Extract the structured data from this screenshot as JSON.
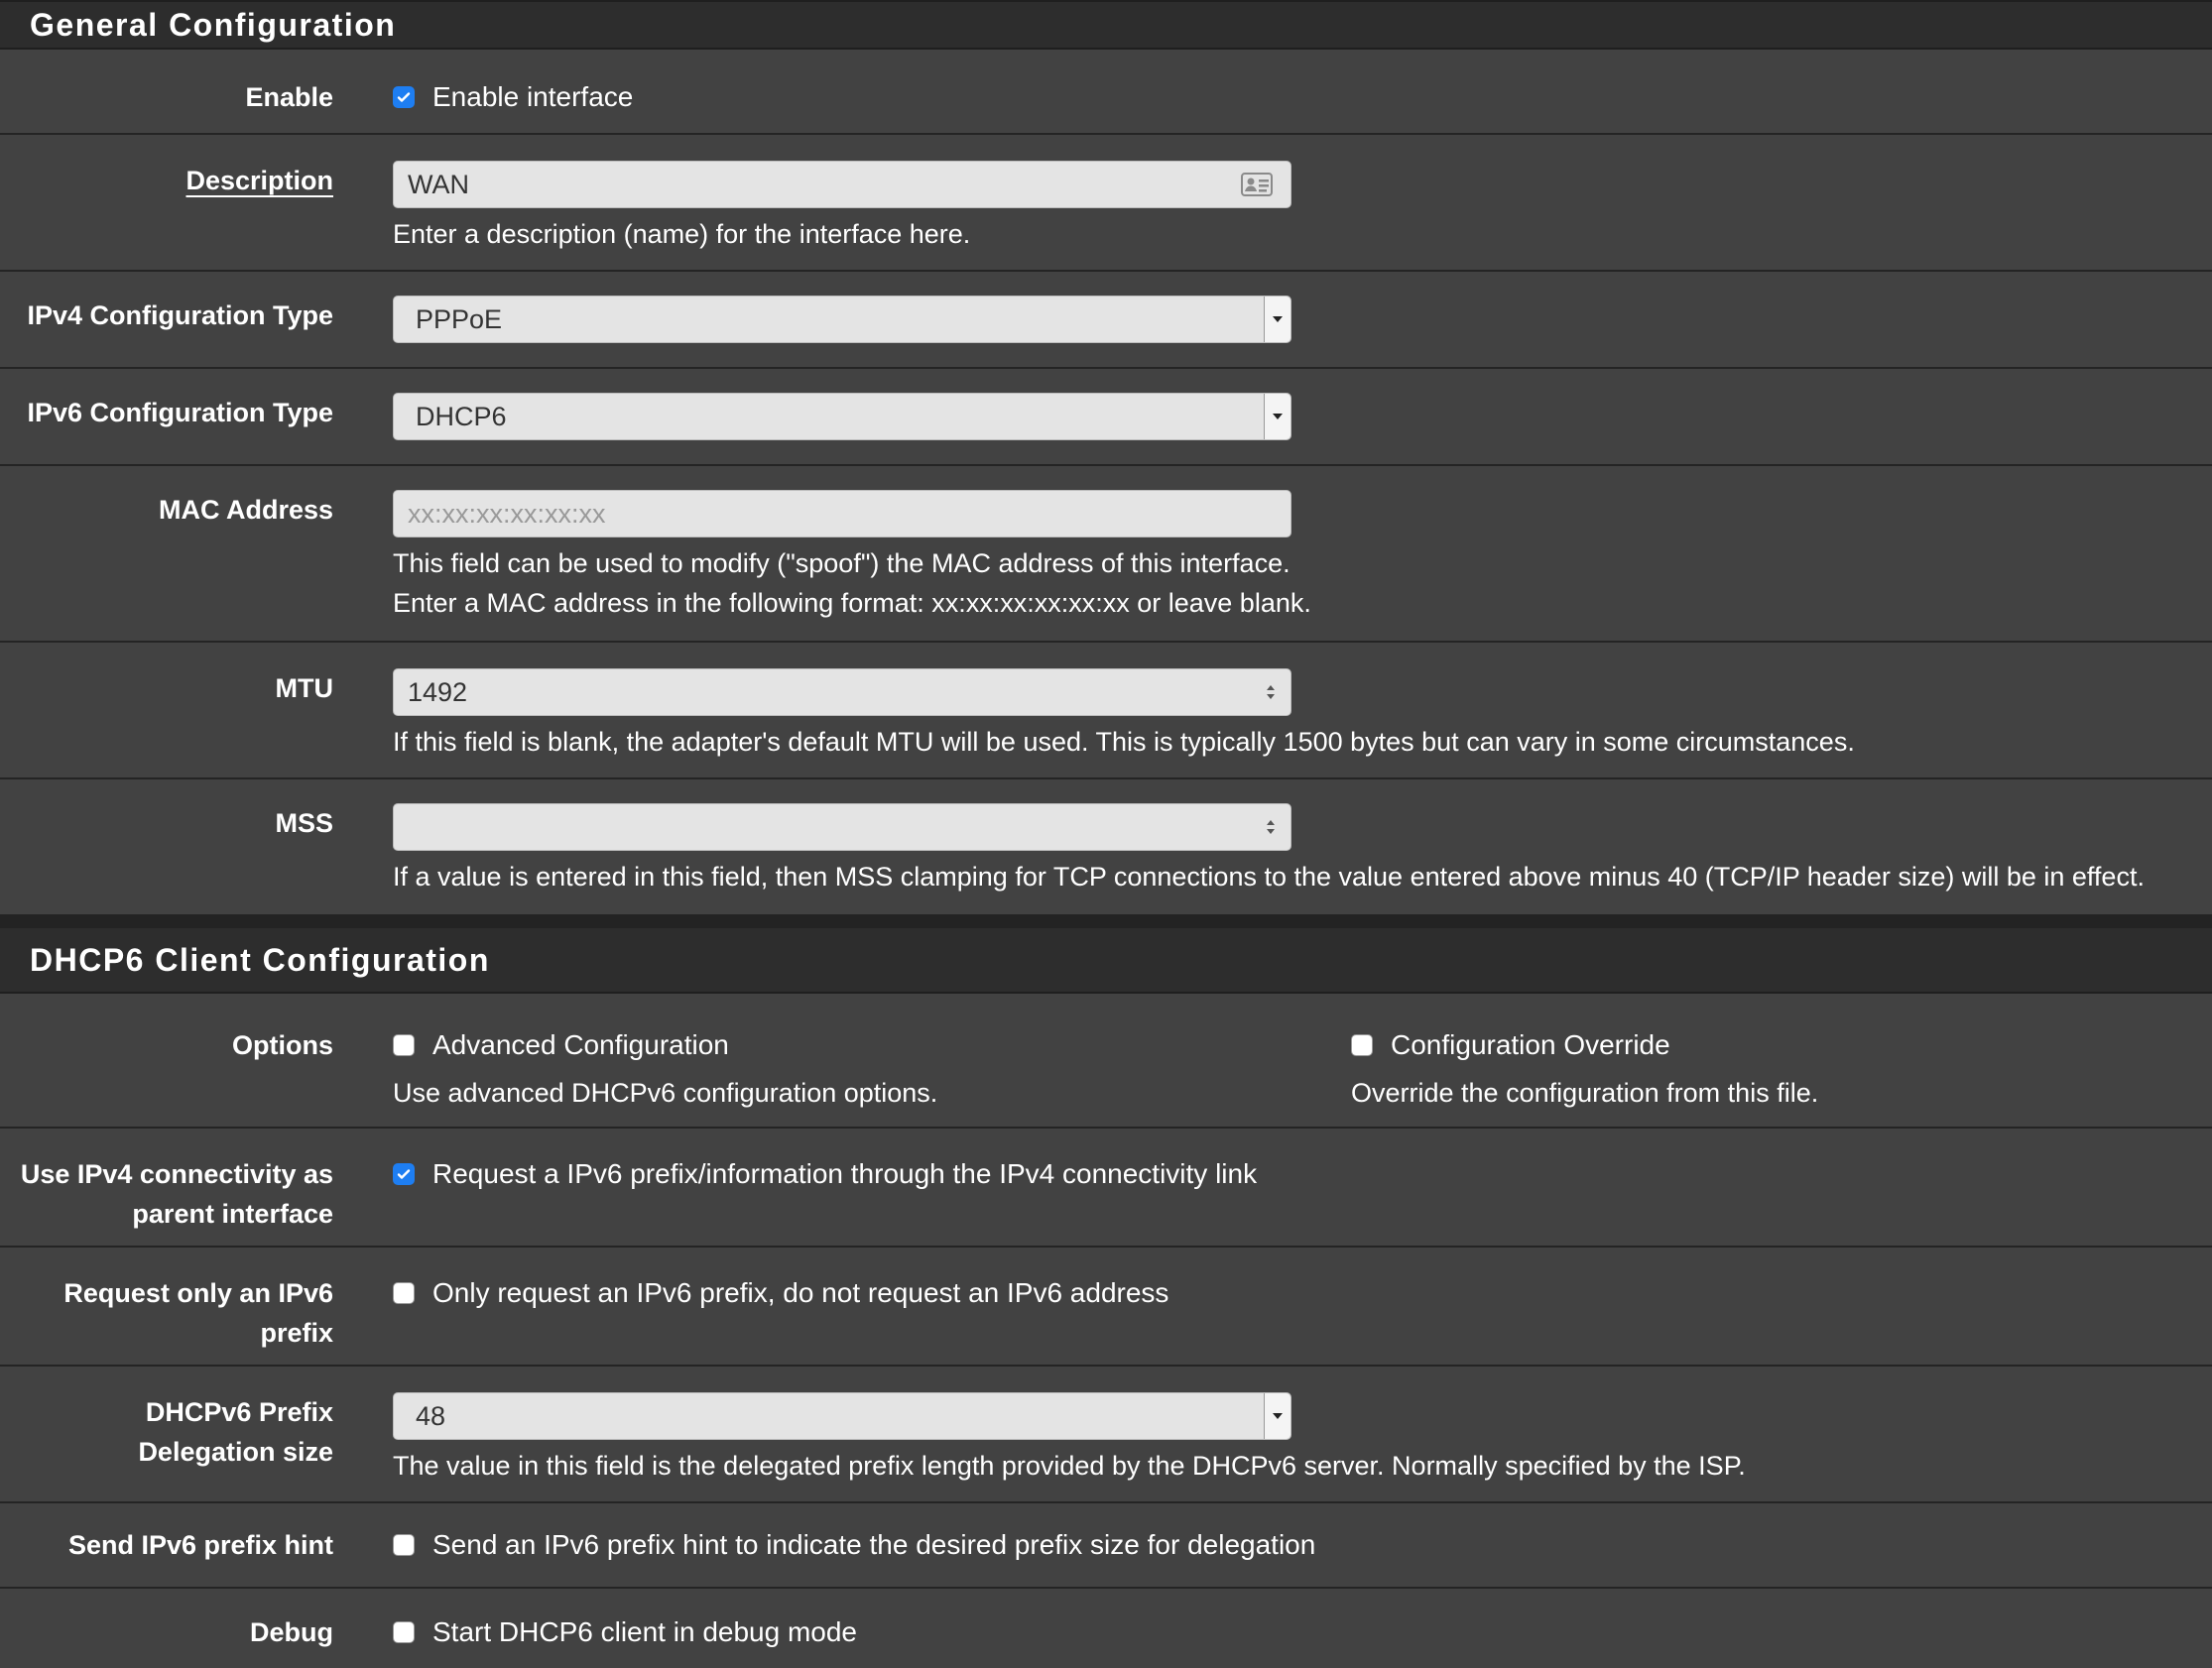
{
  "general": {
    "title": "General Configuration",
    "enable": {
      "label": "Enable",
      "checkbox_label": "Enable interface",
      "checked": true
    },
    "description": {
      "label": "Description",
      "value": "WAN",
      "help": "Enter a description (name) for the interface here."
    },
    "ipv4_type": {
      "label": "IPv4 Configuration Type",
      "value": "PPPoE"
    },
    "ipv6_type": {
      "label": "IPv6 Configuration Type",
      "value": "DHCP6"
    },
    "mac": {
      "label": "MAC Address",
      "placeholder": "xx:xx:xx:xx:xx:xx",
      "help1": "This field can be used to modify (\"spoof\") the MAC address of this interface.",
      "help2": "Enter a MAC address in the following format: xx:xx:xx:xx:xx:xx or leave blank."
    },
    "mtu": {
      "label": "MTU",
      "value": "1492",
      "help": "If this field is blank, the adapter's default MTU will be used. This is typically 1500 bytes but can vary in some circumstances."
    },
    "mss": {
      "label": "MSS",
      "value": "",
      "help": "If a value is entered in this field, then MSS clamping for TCP connections to the value entered above minus 40 (TCP/IP header size) will be in effect."
    }
  },
  "dhcp6": {
    "title": "DHCP6 Client Configuration",
    "options": {
      "label": "Options",
      "advanced_label": "Advanced Configuration",
      "advanced_help": "Use advanced DHCPv6 configuration options.",
      "advanced_checked": false,
      "override_label": "Configuration Override",
      "override_help": "Override the configuration from this file.",
      "override_checked": false
    },
    "use_ipv4": {
      "label_line1": "Use IPv4 connectivity as",
      "label_line2": "parent interface",
      "checkbox_label": "Request a IPv6 prefix/information through the IPv4 connectivity link",
      "checked": true
    },
    "prefix_only": {
      "label_line1": "Request only an IPv6",
      "label_line2": "prefix",
      "checkbox_label": "Only request an IPv6 prefix, do not request an IPv6 address",
      "checked": false
    },
    "delegation": {
      "label_line1": "DHCPv6 Prefix",
      "label_line2": "Delegation size",
      "value": "48",
      "help": "The value in this field is the delegated prefix length provided by the DHCPv6 server. Normally specified by the ISP."
    },
    "hint": {
      "label": "Send IPv6 prefix hint",
      "checkbox_label": "Send an IPv6 prefix hint to indicate the desired prefix size for delegation",
      "checked": false
    },
    "debug": {
      "label": "Debug",
      "checkbox_label": "Start DHCP6 client in debug mode",
      "checked": false
    }
  },
  "icons": {
    "checkmark": "check-icon",
    "dropdown": "caret-down-icon",
    "spinner": "spinner-arrows-icon",
    "contact_card": "address-card-icon"
  },
  "colors": {
    "checkbox_checked": "#1e7ef2",
    "background": "#424242",
    "header": "#2d2d2d"
  }
}
